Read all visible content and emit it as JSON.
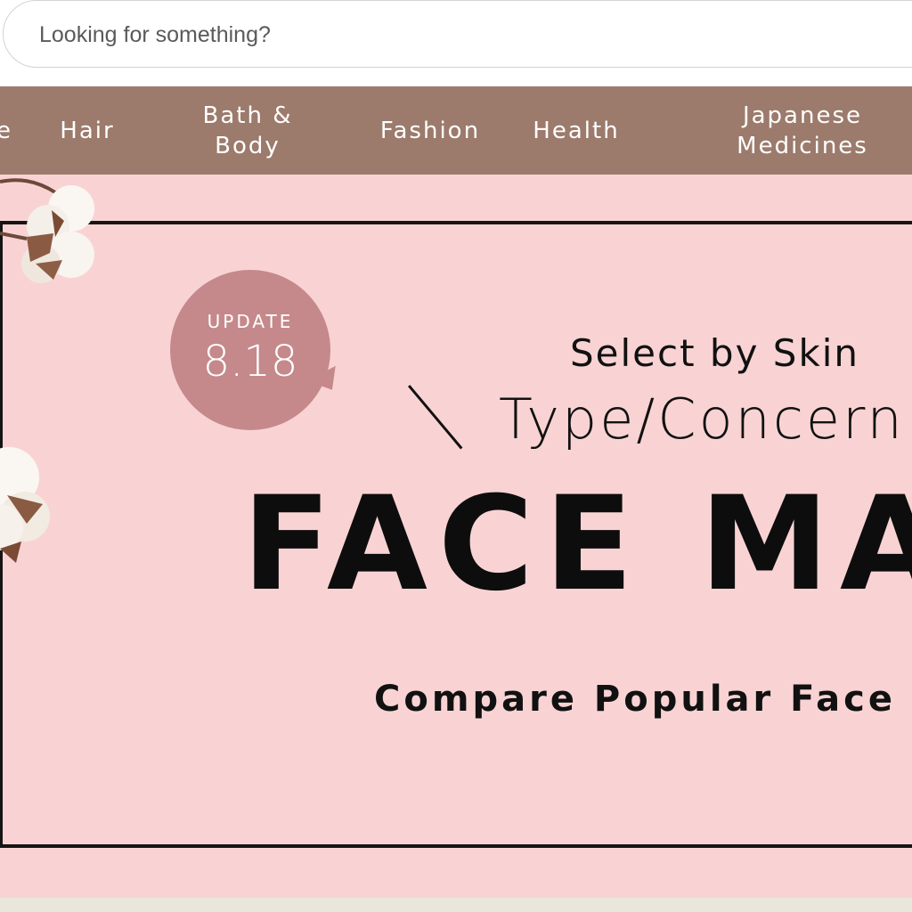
{
  "search": {
    "placeholder": "Looking for something?"
  },
  "nav": {
    "items": [
      {
        "label": "e"
      },
      {
        "label": "Hair"
      },
      {
        "label": "Bath &\nBody"
      },
      {
        "label": "Fashion"
      },
      {
        "label": "Health"
      },
      {
        "label": "Japanese\nMedicines"
      }
    ]
  },
  "banner": {
    "badge_label": "UPDATE",
    "badge_date": "8.18",
    "line1": "Select by Skin",
    "line2": "Type/Concern",
    "headline": "FACE MASK",
    "subline": "Compare Popular Face Masks"
  },
  "colors": {
    "nav_bg": "#9c7b6c",
    "banner_bg": "#f9d3d4",
    "badge_bg": "#c5898b",
    "bottom_strip": "#e9e6dc"
  }
}
